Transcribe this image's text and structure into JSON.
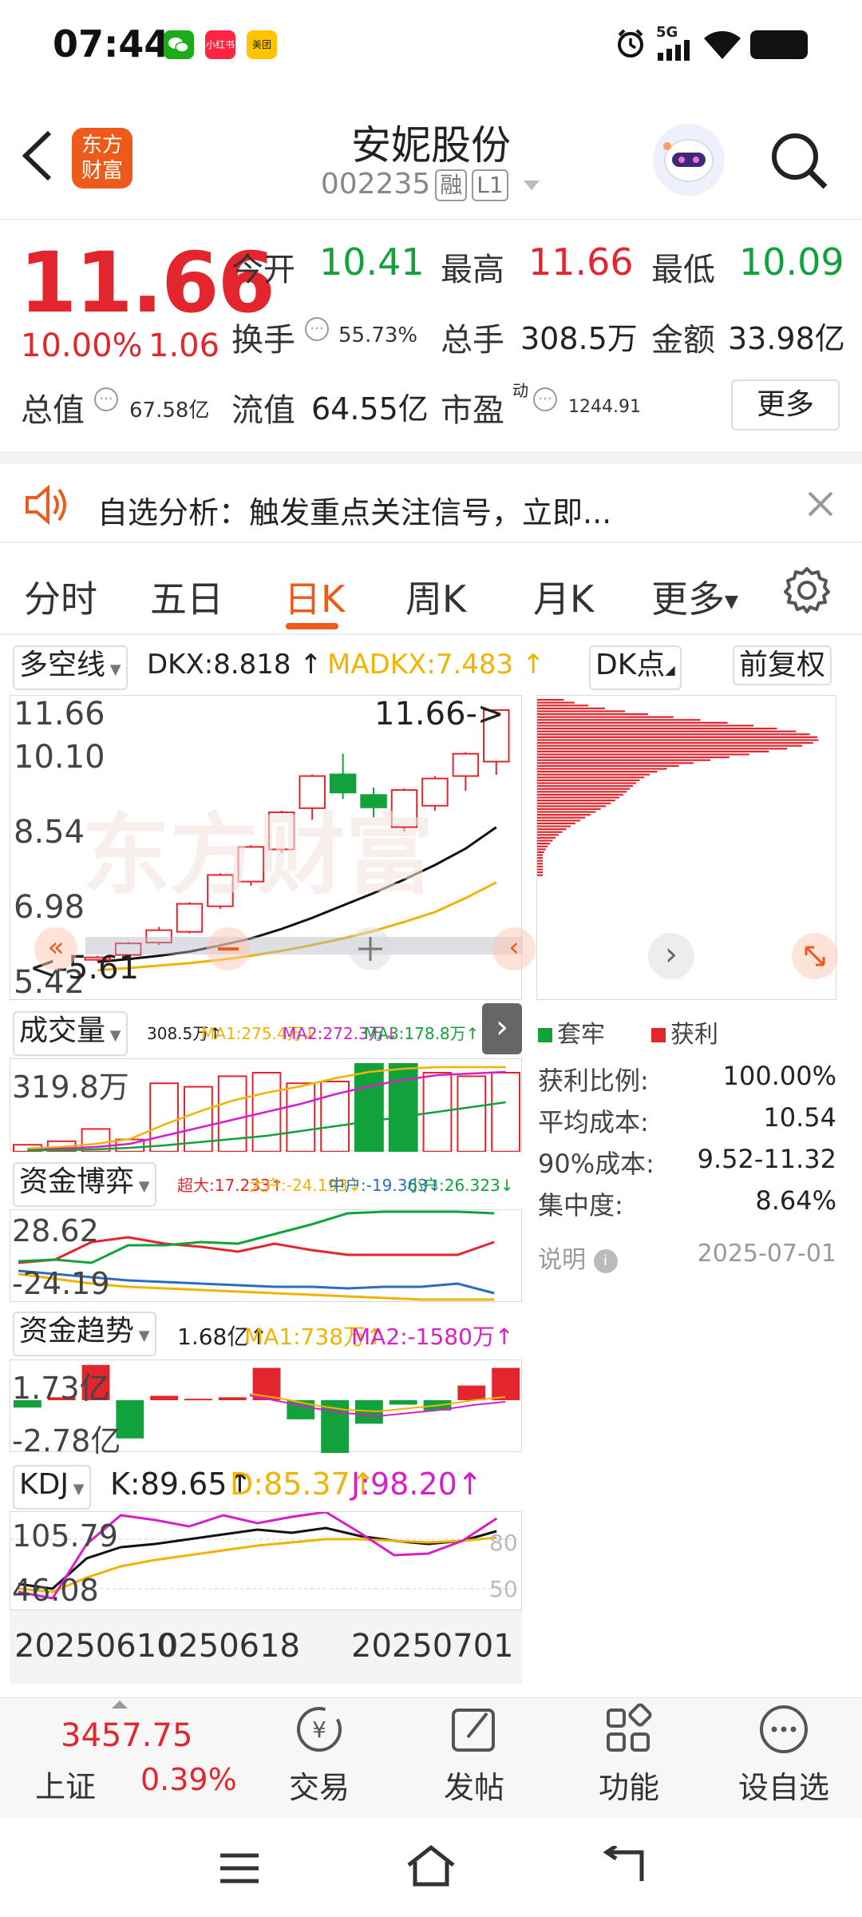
{
  "status_bar": {
    "time": "07:44",
    "apps": [
      "微信",
      "小红书",
      "美团"
    ],
    "network": "5G"
  },
  "header": {
    "brand_logo_text": "东方财富",
    "stock_name": "安妮股份",
    "stock_code": "002235",
    "tag_rong": "融",
    "tag_level": "L1"
  },
  "quote": {
    "price": "11.66",
    "change_pct": "10.00%",
    "change": "1.06",
    "open_label": "今开",
    "open": "10.41",
    "high_label": "最高",
    "high": "11.66",
    "low_label": "最低",
    "low": "10.09",
    "turnover_label": "换手",
    "turnover": "55.73%",
    "volume_label": "总手",
    "volume": "308.5万",
    "amount_label": "金额",
    "amount": "33.98亿",
    "mktcap_label": "总值",
    "mktcap": "67.58亿",
    "float_label": "流值",
    "float_cap": "64.55亿",
    "pe_label": "市盈",
    "pe_sup": "动",
    "pe": "1244.91",
    "more_button": "更多"
  },
  "alert": {
    "text": "自选分析：触发重点关注信号，立即..."
  },
  "tabs": [
    "分时",
    "五日",
    "日K",
    "周K",
    "月K",
    "更多"
  ],
  "active_tab": "日K",
  "chart_header": {
    "indicator_select": "多空线",
    "dkx": "DKX:8.818",
    "madkx": "MADKX:7.483",
    "dk_point": "DK点",
    "adjust": "前复权"
  },
  "kline": {
    "y_labels": [
      "11.66",
      "10.10",
      "8.54",
      "6.98",
      "5.42"
    ],
    "high_marker": "11.66->",
    "low_marker": "<-5.61",
    "watermark": "东方财富"
  },
  "volume_panel": {
    "select": "成交量",
    "vol": "308.5万",
    "ma1": "MA1:275.4万",
    "ma2": "MA2:272.3万",
    "ma3": "MA3:178.8万",
    "y_label": "319.8万"
  },
  "fund_game": {
    "select": "资金博弈",
    "super": "超大:17.233",
    "large": "大户:-24.193",
    "mid": "中户:-19.363",
    "small": "小户:26.323",
    "y_top": "28.62",
    "y_bottom": "-24.19"
  },
  "fund_trend": {
    "select": "资金趋势",
    "val": "1.68亿",
    "ma1": "MA1:738万",
    "ma2": "MA2:-1580万",
    "y_top": "1.73亿",
    "y_bottom": "-2.78亿"
  },
  "kdj": {
    "select": "KDJ",
    "k": "K:89.65",
    "d": "D:85.37",
    "j": "J:98.20",
    "y_top": "105.79",
    "y_bottom": "46.08",
    "ref_80": "80",
    "ref_50": "50"
  },
  "dates": [
    "20250610",
    "20250618",
    "20250701"
  ],
  "chip": {
    "legend_trapped": "套牢",
    "legend_profit": "获利",
    "rows": [
      {
        "label": "获利比例:",
        "value": "100.00%"
      },
      {
        "label": "平均成本:",
        "value": "10.54"
      },
      {
        "label": "90%成本:",
        "value": "9.52-11.32"
      },
      {
        "label": "集中度:",
        "value": "8.64%"
      }
    ],
    "note_label": "说明",
    "note_date": "2025-07-01"
  },
  "bottom_nav": {
    "index_value": "3457.75",
    "index_name": "上证",
    "index_pct": "0.39%",
    "trade": "交易",
    "post": "发帖",
    "func": "功能",
    "watch": "设自选"
  },
  "chart_data": {
    "type": "candlestick",
    "y_range": [
      5.42,
      11.66
    ],
    "candles": [
      {
        "o": 5.62,
        "c": 5.66,
        "h": 5.7,
        "l": 5.56
      },
      {
        "o": 5.72,
        "c": 6.0,
        "h": 6.04,
        "l": 5.7
      },
      {
        "o": 6.02,
        "c": 6.32,
        "h": 6.4,
        "l": 5.96
      },
      {
        "o": 6.28,
        "c": 6.96,
        "h": 7.0,
        "l": 6.24
      },
      {
        "o": 6.9,
        "c": 7.66,
        "h": 7.7,
        "l": 6.84
      },
      {
        "o": 7.5,
        "c": 8.34,
        "h": 8.38,
        "l": 7.4
      },
      {
        "o": 8.28,
        "c": 9.18,
        "h": 9.22,
        "l": 8.2
      },
      {
        "o": 9.28,
        "c": 10.06,
        "h": 10.1,
        "l": 9.0
      },
      {
        "o": 10.1,
        "c": 9.66,
        "h": 10.6,
        "l": 9.5
      },
      {
        "o": 9.6,
        "c": 9.3,
        "h": 9.78,
        "l": 9.06
      },
      {
        "o": 8.82,
        "c": 9.72,
        "h": 9.76,
        "l": 8.7
      },
      {
        "o": 9.34,
        "c": 10.0,
        "h": 10.06,
        "l": 9.22
      },
      {
        "o": 10.06,
        "c": 10.6,
        "h": 10.64,
        "l": 9.7
      },
      {
        "o": 10.41,
        "c": 11.66,
        "h": 11.66,
        "l": 10.09
      }
    ],
    "dkx": [
      5.55,
      5.62,
      5.7,
      5.8,
      5.95,
      6.12,
      6.35,
      6.62,
      6.92,
      7.22,
      7.55,
      7.9,
      8.3,
      8.82
    ],
    "madkx": [
      5.35,
      5.4,
      5.46,
      5.52,
      5.6,
      5.7,
      5.82,
      5.96,
      6.12,
      6.3,
      6.52,
      6.76,
      7.1,
      7.48
    ]
  }
}
